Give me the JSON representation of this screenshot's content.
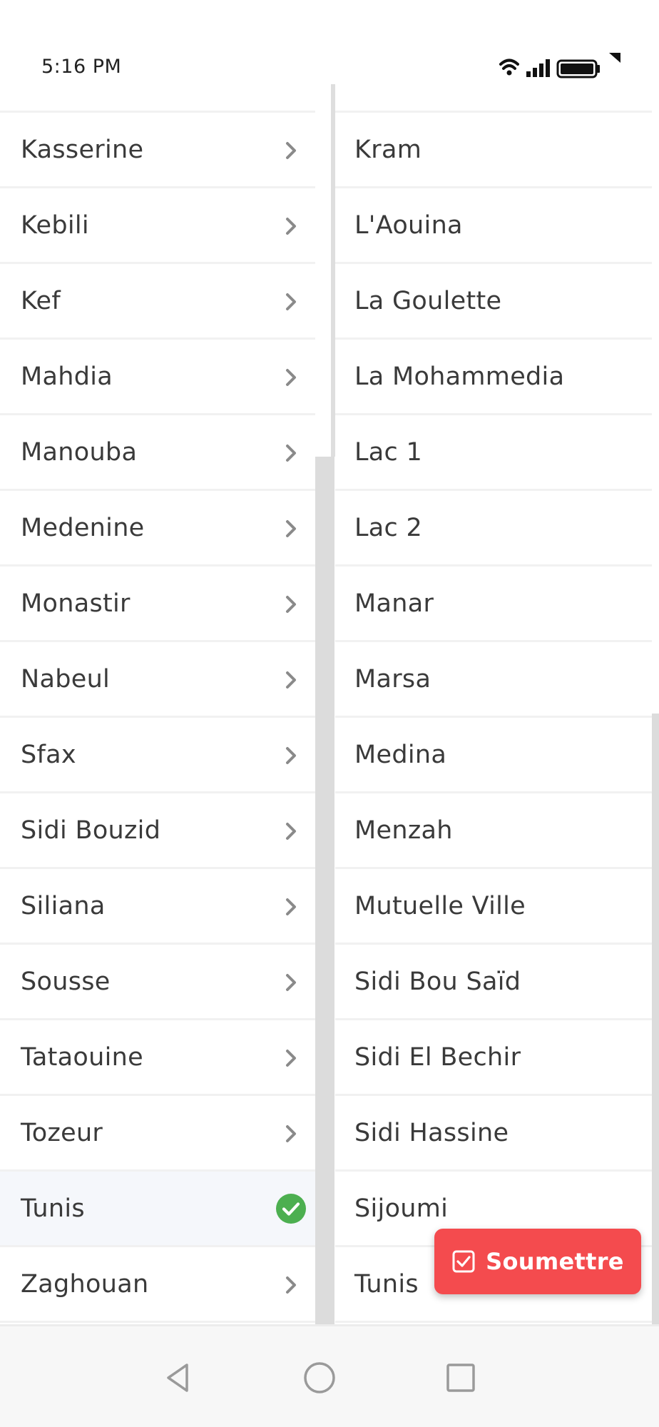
{
  "status_bar": {
    "time": "5:16 PM",
    "icons": [
      "wifi-icon",
      "signal-icon",
      "battery-icon"
    ]
  },
  "left_list": [
    {
      "label": "Kasserine",
      "selected": false
    },
    {
      "label": "Kebili",
      "selected": false
    },
    {
      "label": "Kef",
      "selected": false
    },
    {
      "label": "Mahdia",
      "selected": false
    },
    {
      "label": "Manouba",
      "selected": false
    },
    {
      "label": "Medenine",
      "selected": false
    },
    {
      "label": "Monastir",
      "selected": false
    },
    {
      "label": "Nabeul",
      "selected": false
    },
    {
      "label": "Sfax",
      "selected": false
    },
    {
      "label": "Sidi Bouzid",
      "selected": false
    },
    {
      "label": "Siliana",
      "selected": false
    },
    {
      "label": "Sousse",
      "selected": false
    },
    {
      "label": "Tataouine",
      "selected": false
    },
    {
      "label": "Tozeur",
      "selected": false
    },
    {
      "label": "Tunis",
      "selected": true
    },
    {
      "label": "Zaghouan",
      "selected": false
    }
  ],
  "right_list": [
    "Kram",
    "L'Aouina",
    "La Goulette",
    "La Mohammedia",
    "Lac 1",
    "Lac 2",
    "Manar",
    "Marsa",
    "Medina",
    "Menzah",
    "Mutuelle Ville",
    "Sidi Bou Saïd",
    "Sidi El Bechir",
    "Sidi Hassine",
    "Sijoumi",
    "Tunis"
  ],
  "submit_button": {
    "label": "Soumettre",
    "icon": "checkbox-icon"
  },
  "nav_bar": {
    "icons": [
      "back-icon",
      "home-icon",
      "recents-icon"
    ]
  },
  "colors": {
    "accent": "#f44b4e",
    "check_green": "#4caf50",
    "selected_row_bg": "#f5f7fb",
    "chevron": "#8a8a8a",
    "divider": "#f1f1f1"
  }
}
